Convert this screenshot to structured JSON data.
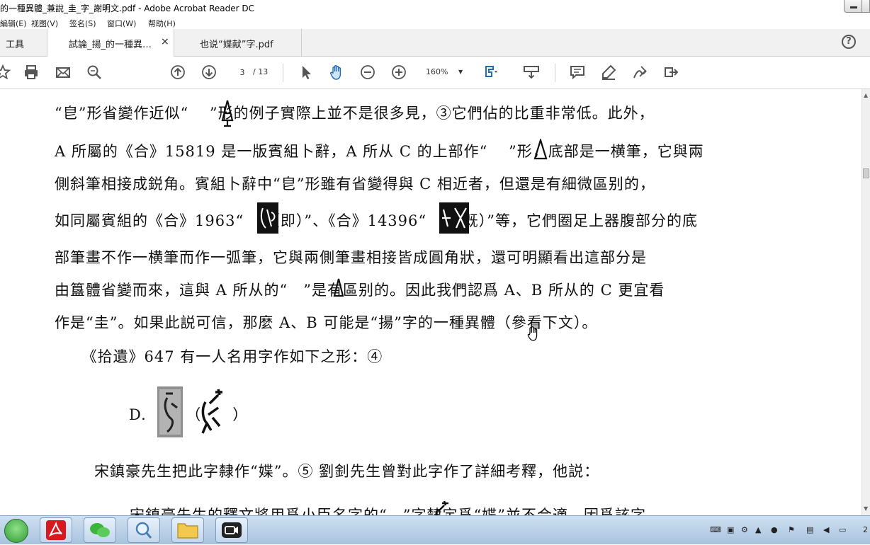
{
  "window": {
    "title": "的一種異體_兼說_圭_字_謝明文.pdf - Adobe Acrobat Reader DC"
  },
  "menu": [
    "編辑(E)",
    "视图(V)",
    "签名(S)",
    "窗口(W)",
    "帮助(H)"
  ],
  "tabs": {
    "tools": "工具",
    "doc1": "試論_揚_的一種異…",
    "doc1_close": "×",
    "doc2": "也说“媟献”字.pdf"
  },
  "toolbar": {
    "page_current": "3",
    "page_total": "/ 13",
    "zoom": "160%",
    "zoom_caret": "▼"
  },
  "icons": [
    "star-icon",
    "print-icon",
    "mail-icon",
    "search-icon",
    "page-up-icon",
    "page-down-icon",
    "select-arrow-icon",
    "hand-icon",
    "zoom-out-icon",
    "zoom-in-icon",
    "fit-page-icon",
    "scroll-mode-icon",
    "comment-icon",
    "highlight-icon",
    "sign-icon",
    "share-icon",
    "help-icon"
  ],
  "document": {
    "lines": [
      "“皀”形省變作近似“　 ”形的例子實際上並不是很多見，③它們佔的比重非常低。此外，",
      "A 所屬的《合》15819 是一版賓組卜辭，A 所从 C 的上部作“　 ”形，底部是一横筆，它與兩",
      "側斜筆相接成鋭角。賓組卜辭中“皀”形雖有省變得與 C 相近者，但還是有細微區别的，",
      "如同屬賓組的《合》1963“　 （即）”、《合》14396“　 （既）”等，它們圈足上器腹部分的底",
      "部筆畫不作一横筆而作一弧筆，它與兩側筆畫相接皆成圓角狀，還可明顯看出這部分是",
      "由簋體省變而來，這與 A 所从的“　”是有區别的。因此我們認爲 A、B 所从的 C 更宜看",
      "作是“圭”。如果此説可信，那麼 A、B 可能是“揚”字的一種異體（參看下文）。",
      "　《拾遺》647 有一人名用字作如下之形：④",
      "D.　　　（　　）",
      "宋鎮豪先生把此字隸作“媟”。⑤  劉釗先生曾對此字作了詳細考釋，他説：",
      "宋鎮豪先生的釋文將用爲小臣名字的“　”字隸定爲“媟”並不合適，因爲該字"
    ]
  },
  "taskbar": {
    "apps": [
      "start-button",
      "acrobat",
      "wechat",
      "search-app",
      "explorer",
      "camera-app"
    ],
    "clock": "2"
  }
}
